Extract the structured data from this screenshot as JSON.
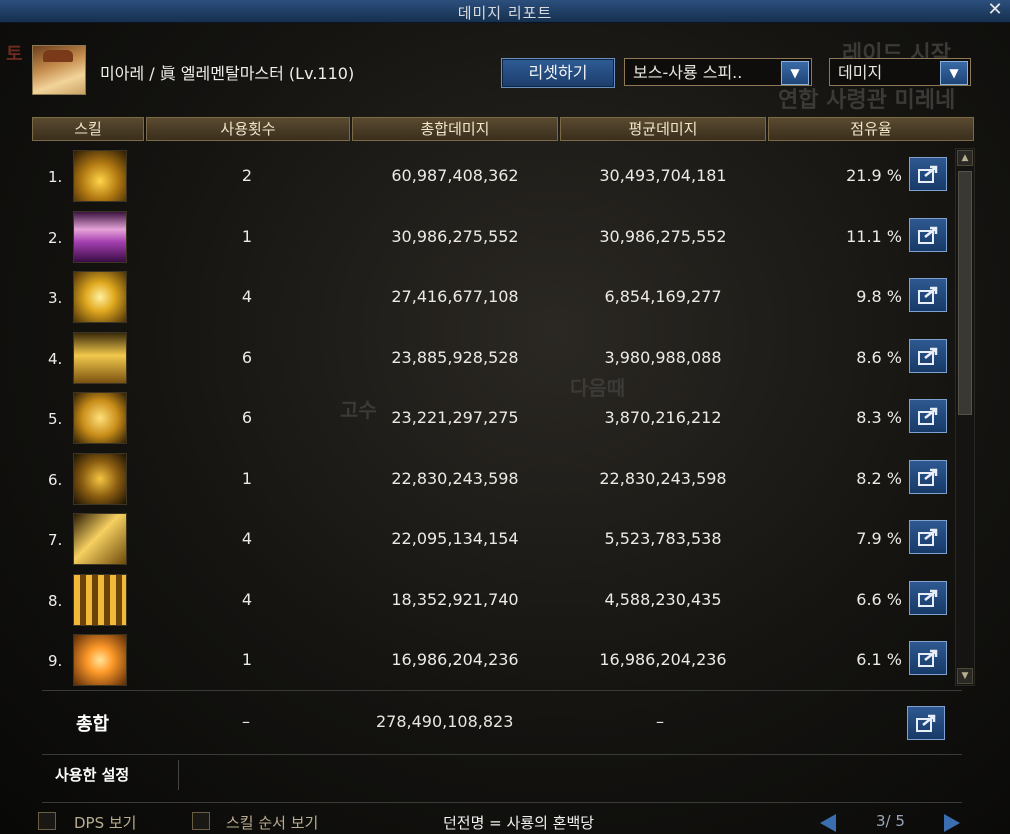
{
  "window": {
    "title": "데미지 리포트",
    "close": "✕"
  },
  "character": {
    "label": "미아레 / 眞 엘레멘탈마스터 (Lv.110)"
  },
  "controls": {
    "reset": "리셋하기",
    "mode": "보스-사룡 스피..",
    "metric": "데미지"
  },
  "columns": [
    "스킬",
    "사용횟수",
    "총합데미지",
    "평균데미지",
    "점유율"
  ],
  "rows": [
    {
      "rank": "1.",
      "uses": "2",
      "total": "60,987,408,362",
      "avg": "30,493,704,181",
      "share": "21.9 %"
    },
    {
      "rank": "2.",
      "uses": "1",
      "total": "30,986,275,552",
      "avg": "30,986,275,552",
      "share": "11.1 %"
    },
    {
      "rank": "3.",
      "uses": "4",
      "total": "27,416,677,108",
      "avg": "6,854,169,277",
      "share": "9.8 %"
    },
    {
      "rank": "4.",
      "uses": "6",
      "total": "23,885,928,528",
      "avg": "3,980,988,088",
      "share": "8.6 %"
    },
    {
      "rank": "5.",
      "uses": "6",
      "total": "23,221,297,275",
      "avg": "3,870,216,212",
      "share": "8.3 %"
    },
    {
      "rank": "6.",
      "uses": "1",
      "total": "22,830,243,598",
      "avg": "22,830,243,598",
      "share": "8.2 %"
    },
    {
      "rank": "7.",
      "uses": "4",
      "total": "22,095,134,154",
      "avg": "5,523,783,538",
      "share": "7.9 %"
    },
    {
      "rank": "8.",
      "uses": "4",
      "total": "18,352,921,740",
      "avg": "4,588,230,435",
      "share": "6.6 %"
    },
    {
      "rank": "9.",
      "uses": "1",
      "total": "16,986,204,236",
      "avg": "16,986,204,236",
      "share": "6.1 %"
    }
  ],
  "total": {
    "label": "총합",
    "uses": "–",
    "total": "278,490,108,823",
    "avg": "–"
  },
  "used_settings": "사용한 설정",
  "footer": {
    "dps": "DPS 보기",
    "skill_order": "스킬 순서 보기",
    "dungeon": "던전명 = 사룡의 혼백당",
    "page": "3/ 5"
  },
  "background_text": [
    "레이드 시작",
    "연합 사령관 미레네",
    "다음때",
    "고수",
    "토"
  ],
  "colors": {
    "accent": "#2e5890",
    "header_gold": "#5a4a30"
  }
}
